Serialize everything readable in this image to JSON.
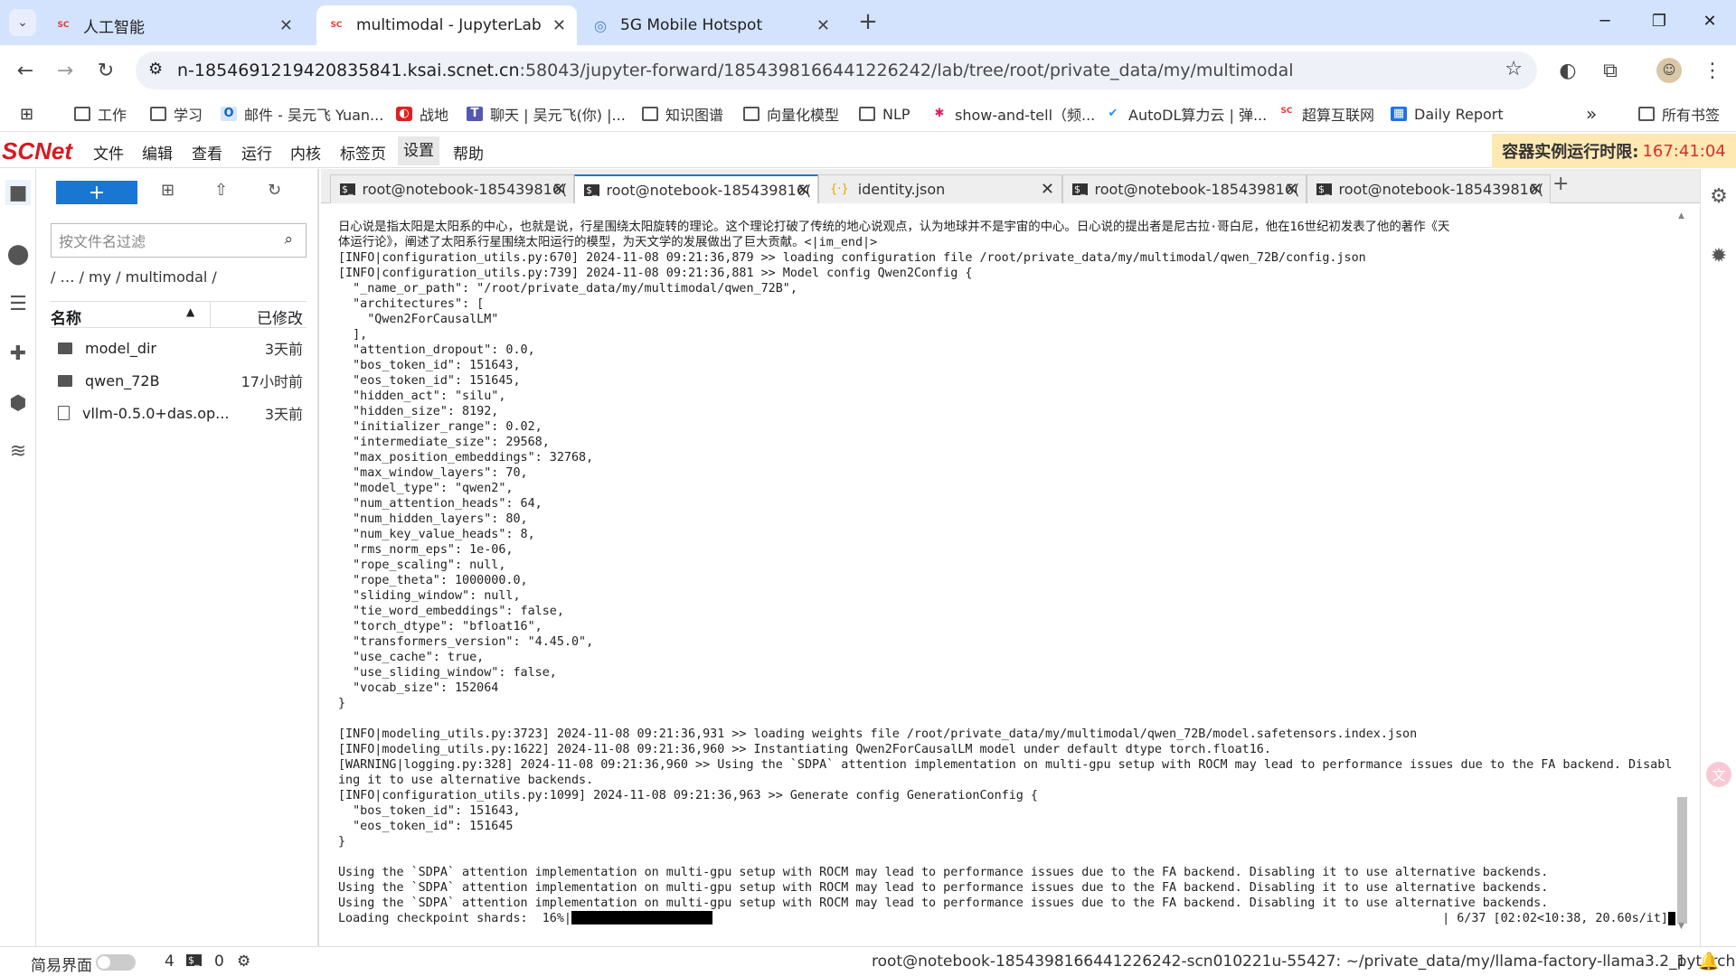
{
  "browser": {
    "tabs": [
      {
        "label": "人工智能",
        "favicon": "scnet"
      },
      {
        "label": "multimodal - JupyterLab",
        "favicon": "scnet"
      },
      {
        "label": "5G Mobile Hotspot",
        "favicon": "globe"
      }
    ],
    "new_tab": "+",
    "url_host": "n-1854691219420835841.ksai.scnet.cn",
    "url_rest": ":58043/jupyter-forward/1854398166441226242/lab/tree/root/private_data/my/multimodal",
    "bookmarks": [
      "工作",
      "学习",
      "邮件 - 吴元飞 Yuan...",
      "战地",
      "聊天 | 吴元飞(你) |...",
      "知识图谱",
      "向量化模型",
      "NLP",
      "show-and-tell（频...",
      "AutoDL算力云 | 弹...",
      "超算互联网",
      "Daily Report"
    ],
    "bookmarks_more": "»",
    "all_bookmarks": "所有书签"
  },
  "jupyter": {
    "logo": "SCNet",
    "menus": [
      "文件",
      "编辑",
      "查看",
      "运行",
      "内核",
      "标签页",
      "设置",
      "帮助"
    ],
    "timer_label": "容器实例运行时限:",
    "timer_value": "167:41:04"
  },
  "filebrowser": {
    "new_label": "+",
    "filter_placeholder": "按文件名过滤",
    "breadcrumb": "/  …  / my / multimodal /",
    "col_name": "名称",
    "col_modified": "已修改",
    "files": [
      {
        "name": "model_dir",
        "type": "folder",
        "modified": "3天前"
      },
      {
        "name": "qwen_72B",
        "type": "folder",
        "modified": "17小时前"
      },
      {
        "name": "vllm-0.5.0+das.op...",
        "type": "file",
        "modified": "3天前"
      }
    ]
  },
  "doc_tabs": [
    {
      "label": "root@notebook-185439816(",
      "icon": "terminal"
    },
    {
      "label": "root@notebook-185439816(",
      "icon": "terminal",
      "active": true
    },
    {
      "label": "identity.json",
      "icon": "json"
    },
    {
      "label": "root@notebook-185439816(",
      "icon": "terminal"
    },
    {
      "label": "root@notebook-185439816(",
      "icon": "terminal"
    }
  ],
  "terminal_lines": [
    "日心说是指太阳是太阳系的中心，也就是说，行星围绕太阳旋转的理论。这个理论打破了传统的地心说观点，认为地球并不是宇宙的中心。日心说的提出者是尼古拉·哥白尼，他在16世纪初发表了他的著作《天",
    "体运行论》，阐述了太阳系行星围绕太阳运行的模型，为天文学的发展做出了巨大贡献。<|im_end|>",
    "[INFO|configuration_utils.py:670] 2024-11-08 09:21:36,879 >> loading configuration file /root/private_data/my/multimodal/qwen_72B/config.json",
    "[INFO|configuration_utils.py:739] 2024-11-08 09:21:36,881 >> Model config Qwen2Config {",
    "  \"_name_or_path\": \"/root/private_data/my/multimodal/qwen_72B\",",
    "  \"architectures\": [",
    "    \"Qwen2ForCausalLM\"",
    "  ],",
    "  \"attention_dropout\": 0.0,",
    "  \"bos_token_id\": 151643,",
    "  \"eos_token_id\": 151645,",
    "  \"hidden_act\": \"silu\",",
    "  \"hidden_size\": 8192,",
    "  \"initializer_range\": 0.02,",
    "  \"intermediate_size\": 29568,",
    "  \"max_position_embeddings\": 32768,",
    "  \"max_window_layers\": 70,",
    "  \"model_type\": \"qwen2\",",
    "  \"num_attention_heads\": 64,",
    "  \"num_hidden_layers\": 80,",
    "  \"num_key_value_heads\": 8,",
    "  \"rms_norm_eps\": 1e-06,",
    "  \"rope_scaling\": null,",
    "  \"rope_theta\": 1000000.0,",
    "  \"sliding_window\": null,",
    "  \"tie_word_embeddings\": false,",
    "  \"torch_dtype\": \"bfloat16\",",
    "  \"transformers_version\": \"4.45.0\",",
    "  \"use_cache\": true,",
    "  \"use_sliding_window\": false,",
    "  \"vocab_size\": 152064",
    "}",
    "",
    "[INFO|modeling_utils.py:3723] 2024-11-08 09:21:36,931 >> loading weights file /root/private_data/my/multimodal/qwen_72B/model.safetensors.index.json",
    "[INFO|modeling_utils.py:1622] 2024-11-08 09:21:36,960 >> Instantiating Qwen2ForCausalLM model under default dtype torch.float16.",
    "[WARNING|logging.py:328] 2024-11-08 09:21:36,960 >> Using the `SDPA` attention implementation on multi-gpu setup with ROCM may lead to performance issues due to the FA backend. Disabl",
    "ing it to use alternative backends.",
    "[INFO|configuration_utils.py:1099] 2024-11-08 09:21:36,963 >> Generate config GenerationConfig {",
    "  \"bos_token_id\": 151643,",
    "  \"eos_token_id\": 151645",
    "}",
    "",
    "Using the `SDPA` attention implementation on multi-gpu setup with ROCM may lead to performance issues due to the FA backend. Disabling it to use alternative backends.",
    "Using the `SDPA` attention implementation on multi-gpu setup with ROCM may lead to performance issues due to the FA backend. Disabling it to use alternative backends.",
    "Using the `SDPA` attention implementation on multi-gpu setup with ROCM may lead to performance issues due to the FA backend. Disabling it to use alternative backends."
  ],
  "progress": {
    "label": "Loading checkpoint shards:  16%|",
    "fraction": 0.16,
    "tail": "| 6/37 [02:02<10:38, 20.60s/it]"
  },
  "statusbar": {
    "simple_mode": "简易界面",
    "kernels": "4",
    "terminals": "0",
    "path": "root@notebook-1854398166441226242-scn010221u-55427: ~/private_data/my/llama-factory-llama3.2_pytorch",
    "count": "1"
  },
  "colors": {
    "accent": "#1976d2",
    "brand": "#d71920",
    "timer_bg": "#ffe9b3"
  }
}
